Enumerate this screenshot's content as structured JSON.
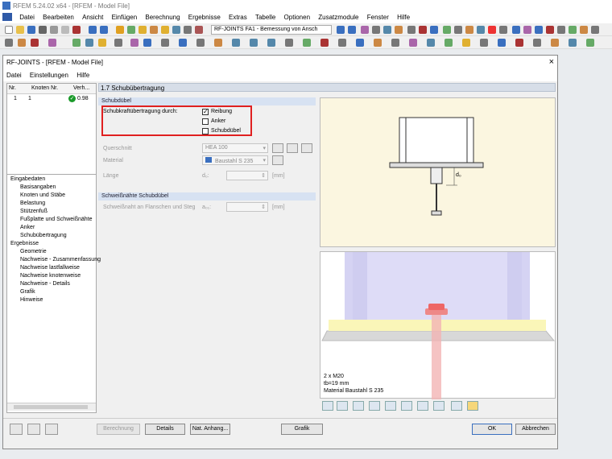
{
  "app": {
    "title": "RFEM 5.24.02 x64 - [RFEM - Model File]"
  },
  "menu": [
    "Datei",
    "Bearbeiten",
    "Ansicht",
    "Einfügen",
    "Berechnung",
    "Ergebnisse",
    "Extras",
    "Tabelle",
    "Optionen",
    "Zusatzmodule",
    "Fenster",
    "Hilfe"
  ],
  "toolbar": {
    "module_combo": "RF-JOINTS FA1 - Bemessung von Ansch"
  },
  "dialog": {
    "title": "RF-JOINTS - [RFEM - Model File]",
    "close": "×",
    "menu": [
      "Datei",
      "Einstellungen",
      "Hilfe"
    ]
  },
  "grid": {
    "headers": [
      "Nr.",
      "Knoten Nr.",
      "Verh..."
    ],
    "rows": [
      {
        "nr": "1",
        "node": "1",
        "ratio": "0.98",
        "status": "ok"
      }
    ]
  },
  "nav": {
    "groups": [
      {
        "label": "Eingabedaten",
        "children": [
          "Basisangaben",
          "Knoten und Stäbe",
          "Belastung",
          "Stützenfuß",
          "Fußplatte und Schweißnähte",
          "Anker",
          "Schubübertragung"
        ]
      },
      {
        "label": "Ergebnisse",
        "children": [
          "Geometrie",
          "Nachweise - Zusammenfassung",
          "Nachweise lastfallweise",
          "Nachweise knotenweise",
          "Nachweise - Details",
          "Grafik",
          "Hinweise"
        ]
      }
    ]
  },
  "section": {
    "title": "1.7 Schubübertragung"
  },
  "schubduebel": {
    "title": "Schubdübel",
    "transfer_label": "Schubkraftübertragung durch:",
    "options": [
      {
        "label": "Reibung",
        "checked": true
      },
      {
        "label": "Anker",
        "checked": false
      },
      {
        "label": "Schubdübel",
        "checked": false
      }
    ],
    "querschnitt_label": "Querschnitt",
    "querschnitt_value": "HEA 100",
    "material_label": "Material",
    "material_value": "Baustahl S 235",
    "laenge_label": "Länge",
    "laenge_symbol": "d₀:",
    "laenge_unit": "[mm]"
  },
  "schweiss": {
    "title": "Schweißnähte Schubdübel",
    "label": "Schweißnaht an Flanschen und Steg",
    "symbol": "a₀₁:",
    "unit": "[mm]"
  },
  "gfx": {
    "dim_label": "d₀",
    "caption": [
      "2 x M20",
      "tb=19 mm",
      "Material Baustahl S 235"
    ]
  },
  "buttons": {
    "berechnung": "Berechnung",
    "details": "Details",
    "nat_anhang": "Nat. Anhang...",
    "grafik": "Grafik",
    "ok": "OK",
    "abbrechen": "Abbrechen"
  },
  "colors": {
    "accent": "#2f5aa8",
    "highlight": "#e02020",
    "ok": "#1a9a2a",
    "plate": "#faf6b8",
    "column": "#c9c6ee",
    "bolt": "#f0a0a0"
  }
}
